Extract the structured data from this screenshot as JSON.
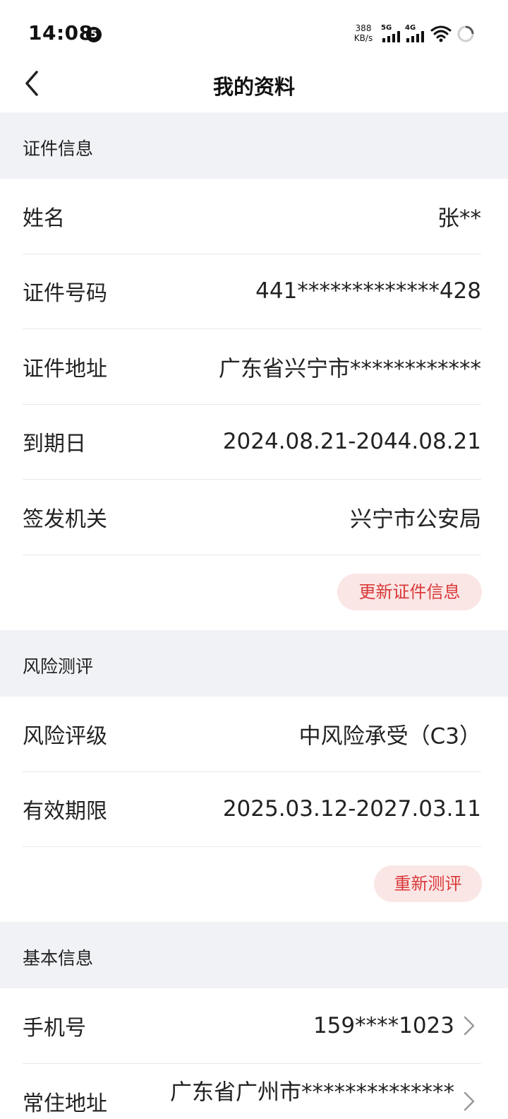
{
  "status_bar": {
    "time": "14:08",
    "notification_count": "5",
    "net_speed_value": "388",
    "net_speed_unit": "KB/s",
    "sim1_label": "5G",
    "sim2_label": "4G",
    "icons": [
      "signal-icon",
      "wifi-icon",
      "loading-icon"
    ]
  },
  "header": {
    "title": "我的资料",
    "back_icon": "chevron-left-icon"
  },
  "sections": {
    "id_info": {
      "title": "证件信息",
      "rows": [
        {
          "label": "姓名",
          "value": "张**"
        },
        {
          "label": "证件号码",
          "value": "441*************428"
        },
        {
          "label": "证件地址",
          "value": "广东省兴宁市************"
        },
        {
          "label": "到期日",
          "value": "2024.08.21-2044.08.21"
        },
        {
          "label": "签发机关",
          "value": "兴宁市公安局"
        }
      ],
      "action_label": "更新证件信息"
    },
    "risk": {
      "title": "风险测评",
      "rows": [
        {
          "label": "风险评级",
          "value": "中风险承受（C3）"
        },
        {
          "label": "有效期限",
          "value": "2025.03.12-2027.03.11"
        }
      ],
      "action_label": "重新测评"
    },
    "basic": {
      "title": "基本信息",
      "rows": [
        {
          "label": "手机号",
          "value": "159****1023"
        },
        {
          "label": "常住地址",
          "value": "广东省广州市**************"
        }
      ]
    }
  },
  "colors": {
    "accent": "#d93a3a",
    "accent_bg": "#fbe6e6",
    "section_bg": "#f1f2f6",
    "divider": "#e8e8e8"
  }
}
